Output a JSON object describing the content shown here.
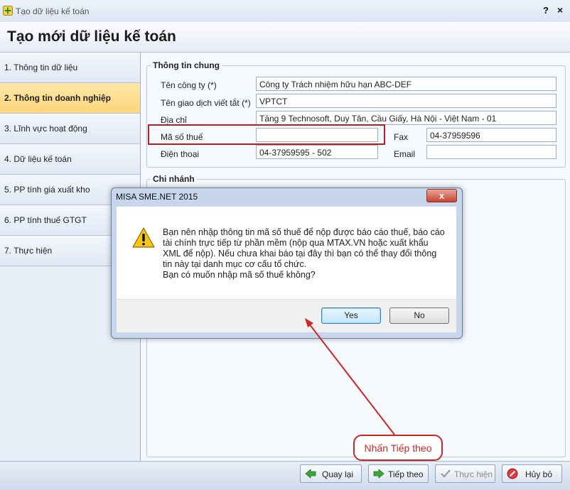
{
  "window": {
    "title": "Tạo dữ liệu kế toán",
    "help": "?",
    "close": "×"
  },
  "header": {
    "title": "Tạo mới dữ liệu kế toán"
  },
  "sidebar": {
    "items": [
      {
        "label": "1. Thông tin dữ liệu",
        "active": false
      },
      {
        "label": "2. Thông tin doanh nghiệp",
        "active": true
      },
      {
        "label": "3. Lĩnh vực hoạt động",
        "active": false
      },
      {
        "label": "4. Dữ liệu kế toán",
        "active": false
      },
      {
        "label": "5. PP tính giá xuất kho",
        "active": false
      },
      {
        "label": "6. PP tính thuế GTGT",
        "active": false
      },
      {
        "label": "7. Thực hiện",
        "active": false
      }
    ]
  },
  "form": {
    "group_general": "Thông tin chung",
    "company_name_label": "Tên công ty (*)",
    "company_name_value": "Công ty Trách nhiệm hữu hạn ABC-DEF",
    "short_name_label": "Tên giao dịch viết tắt (*)",
    "short_name_value": "VPTCT",
    "address_label": "Địa chỉ",
    "address_value": "Tầng 9 Technosoft, Duy Tân, Cầu Giấy, Hà Nội - Việt Nam - 01",
    "tax_code_label": "Mã số thuế",
    "tax_code_value": "",
    "fax_label": "Fax",
    "fax_value": "04-37959596",
    "phone_label": "Điện thoại",
    "phone_value": "04-37959595 - 502",
    "email_label": "Email",
    "email_value": "",
    "group_branch": "Chi nhánh"
  },
  "dialog": {
    "title": "MISA SME.NET 2015",
    "close": "x",
    "message_lines": [
      "Bạn nên nhập thông tin mã số thuế để nộp được báo cáo thuế, báo cáo",
      "tài chính trực tiếp từ phần mềm (nộp qua MTAX.VN hoặc xuất khẩu",
      "XML để nộp). Nếu chưa khai báo tại đây thì bạn có thể thay đổi thông",
      "tin này tại danh mục cơ cấu tổ chức.",
      "Bạn có muốn nhập mã số thuế không?"
    ],
    "yes": "Yes",
    "no": "No"
  },
  "footer": {
    "back": "Quay lại",
    "next": "Tiếp theo",
    "execute": "Thực hiện",
    "cancel": "Hủy bỏ"
  },
  "annotation": {
    "callout": "Nhấn Tiếp theo"
  },
  "colors": {
    "highlight": "#b22222",
    "annotation": "#c62828",
    "active_step": "#ffd67a"
  }
}
